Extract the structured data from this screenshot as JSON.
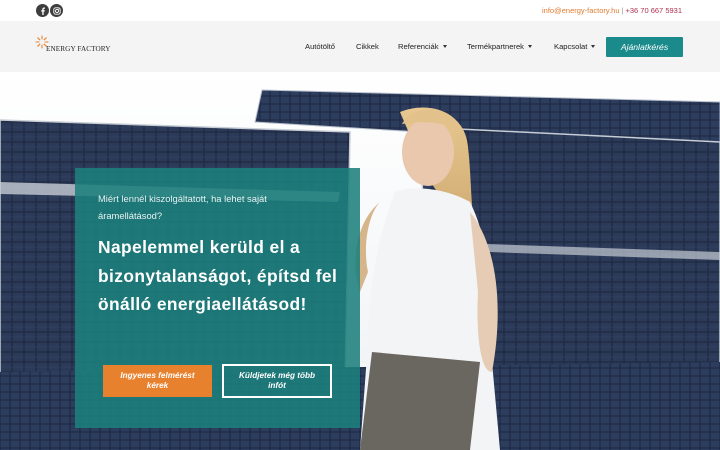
{
  "topbar": {
    "social": [
      {
        "name": "facebook-icon"
      },
      {
        "name": "instagram-icon"
      }
    ],
    "email": "info@energy-factory.hu",
    "separator": "|",
    "phone": "+36 70 667 5931"
  },
  "header": {
    "logo_text": "ENERGY FACTORY",
    "nav": [
      {
        "label": "Autótöltő",
        "dropdown": false
      },
      {
        "label": "Cikkek",
        "dropdown": false
      },
      {
        "label": "Referenciák",
        "dropdown": true
      },
      {
        "label": "Termékpartnerek",
        "dropdown": true
      },
      {
        "label": "Kapcsolat",
        "dropdown": true
      }
    ],
    "cta": "Ajánlatkérés"
  },
  "hero": {
    "subtitle": "Miért lennél kiszolgáltatott, ha lehet saját áramellátásod?",
    "title": "Napelemmel kerüld el a bizonytalanságot, építsd fel önálló energiaellátásod!",
    "primary_button": "Ingyenes felmérést kérek",
    "secondary_button": "Küldjetek még több infót"
  },
  "colors": {
    "accent": "#1a8a8a",
    "orange": "#e8812e",
    "panel": "#1c807c"
  }
}
